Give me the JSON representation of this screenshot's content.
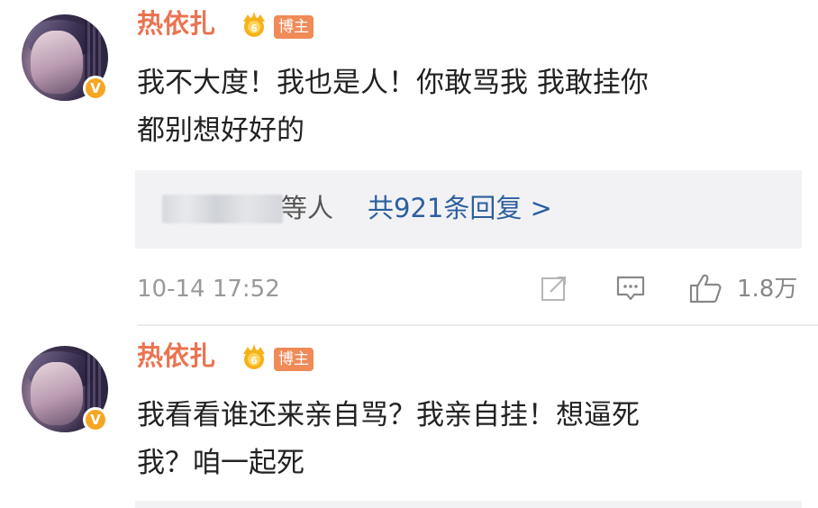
{
  "comments": [
    {
      "username": "热依扎",
      "author_tag": "博主",
      "verified_badge": "V",
      "lines": [
        "我不大度！我也是人！你敢骂我 我敢挂你",
        "都别想好好的"
      ],
      "replies": {
        "suffix": "等人",
        "count_label": "共921条回复 >"
      },
      "timestamp": "10-14 17:52",
      "likes": "1.8万"
    },
    {
      "username": "热依扎",
      "author_tag": "博主",
      "verified_badge": "V",
      "lines": [
        "我看看谁还来亲自骂？我亲自挂！想逼死",
        "我？咱一起死"
      ]
    }
  ],
  "icons": {
    "share": "share-icon",
    "comment": "comment-icon",
    "like": "thumbs-up-icon",
    "crown": "crown-level-icon"
  },
  "colors": {
    "username": "#eb7350",
    "link": "#2c5f9e",
    "badge": "#f5a623",
    "tag": "#f08a57"
  }
}
